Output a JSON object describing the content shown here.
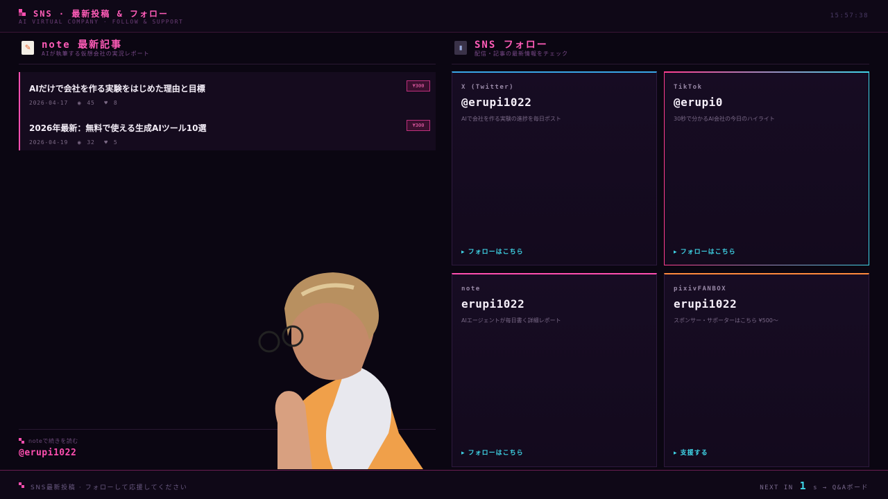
{
  "header": {
    "title": "SNS · 最新投稿 & フォロー",
    "subtitle": "AI VIRTUAL COMPANY · FOLLOW & SUPPORT",
    "clock": "15:57:38"
  },
  "left": {
    "icon": "memo-icon",
    "title": "note 最新記事",
    "subtitle": "AIが執筆する仮想会社の実況レポート",
    "articles": [
      {
        "title": "AIだけで会社を作る実験をはじめた理由と目標",
        "date": "2026-04-17",
        "views": "45",
        "likes": "8",
        "price": "¥300"
      },
      {
        "title": "2026年最新：無料で使える生成AIツール10選",
        "date": "2026-04-19",
        "views": "32",
        "likes": "5",
        "price": "¥300"
      }
    ],
    "cta_label": "noteで続きを読む",
    "cta_handle": "@erupi1022"
  },
  "right": {
    "icon": "phone-icon",
    "title": "SNS フォロー",
    "subtitle": "配信・記事の最新情報をチェック",
    "cards": [
      {
        "platform": "X (Twitter)",
        "handle": "@erupi1022",
        "desc": "AIで会社を作る実験の進捗を毎日ポスト",
        "link": "▸ フォローはこちら",
        "accent": "#3aa8e8"
      },
      {
        "platform": "TikTok",
        "handle": "@erupi0",
        "desc": "30秒で分かるAI会社の今日のハイライト",
        "link": "▸ フォローはこちら",
        "accent": "#ff3d8f"
      },
      {
        "platform": "note",
        "handle": "erupi1022",
        "desc": "AIエージェントが毎日書く詳細レポート",
        "link": "▸ フォローはこちら",
        "accent": "#ff4fb0"
      },
      {
        "platform": "pixivFANBOX",
        "handle": "erupi1022",
        "desc": "スポンサー・サポーターはこちら ¥500〜",
        "link": "▸ 支援する",
        "accent": "#ff8a3d"
      }
    ]
  },
  "footer": {
    "text": "SNS最新投稿 · フォローして応援してください",
    "next_prefix": "NEXT IN",
    "next_num": "1",
    "next_suffix": "s → Q&Aボード"
  }
}
